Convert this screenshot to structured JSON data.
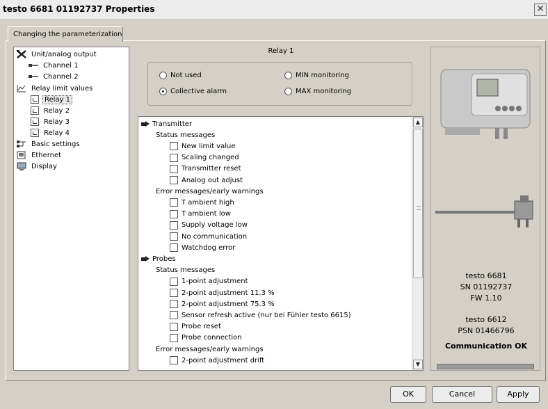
{
  "window": {
    "title": "testo 6681  01192737 Properties",
    "close_glyph": "✕"
  },
  "tab": {
    "label": "Changing the parameterization"
  },
  "tree": {
    "items": [
      {
        "label": "Unit/analog output",
        "icon": "tools-icon"
      },
      {
        "label": "Channel 1",
        "icon": "cable-icon"
      },
      {
        "label": "Channel 2",
        "icon": "cable-icon"
      },
      {
        "label": "Relay limit values",
        "icon": "chart-icon"
      },
      {
        "label": "Relay 1",
        "icon": "relay-icon",
        "selected": true
      },
      {
        "label": "Relay 2",
        "icon": "relay-icon"
      },
      {
        "label": "Relay 3",
        "icon": "relay-icon"
      },
      {
        "label": "Relay 4",
        "icon": "relay-icon"
      },
      {
        "label": "Basic settings",
        "icon": "network-icon"
      },
      {
        "label": "Ethernet",
        "icon": "ethernet-icon"
      },
      {
        "label": "Display",
        "icon": "display-icon"
      }
    ]
  },
  "relay": {
    "title": "Relay 1",
    "options": [
      {
        "label": "Not used",
        "selected": false
      },
      {
        "label": "MIN monitoring",
        "selected": false
      },
      {
        "label": "Collective alarm",
        "selected": true
      },
      {
        "label": "MAX monitoring",
        "selected": false
      }
    ]
  },
  "alarm_list": {
    "rows": [
      {
        "type": "group",
        "label": "Transmitter"
      },
      {
        "type": "header",
        "label": "Status messages"
      },
      {
        "type": "check",
        "label": "New limit value",
        "checked": false
      },
      {
        "type": "check",
        "label": "Scaling changed",
        "checked": false
      },
      {
        "type": "check",
        "label": "Transmitter reset",
        "checked": false
      },
      {
        "type": "check",
        "label": "Analog out adjust",
        "checked": false
      },
      {
        "type": "header",
        "label": "Error messages/early warnings"
      },
      {
        "type": "check",
        "label": "T ambient high",
        "checked": false
      },
      {
        "type": "check",
        "label": "T ambient low",
        "checked": false
      },
      {
        "type": "check",
        "label": "Supply voltage low",
        "checked": false
      },
      {
        "type": "check",
        "label": "No communication",
        "checked": false
      },
      {
        "type": "check",
        "label": "Watchdog error",
        "checked": false
      },
      {
        "type": "group",
        "label": "Probes"
      },
      {
        "type": "header",
        "label": "Status messages"
      },
      {
        "type": "check",
        "label": "1-point adjustment",
        "checked": false
      },
      {
        "type": "check",
        "label": "2-point adjustment 11.3 %",
        "checked": false
      },
      {
        "type": "check",
        "label": "2-point adjustment 75.3 %",
        "checked": false
      },
      {
        "type": "check",
        "label": "Sensor refresh active (nur bei Fühler testo 6615)",
        "checked": false
      },
      {
        "type": "check",
        "label": "Probe reset",
        "checked": false
      },
      {
        "type": "check",
        "label": "Probe connection",
        "checked": false
      },
      {
        "type": "header",
        "label": "Error messages/early warnings"
      },
      {
        "type": "check",
        "label": "2-point adjustment drift",
        "checked": false
      }
    ]
  },
  "device": {
    "model": "testo 6681",
    "serial": "SN 01192737",
    "firmware": "FW  1.10",
    "probe_model": "testo 6612",
    "probe_serial": "PSN 01466796",
    "status": "Communication OK"
  },
  "buttons": {
    "ok": "OK",
    "cancel": "Cancel",
    "apply": "Apply"
  }
}
